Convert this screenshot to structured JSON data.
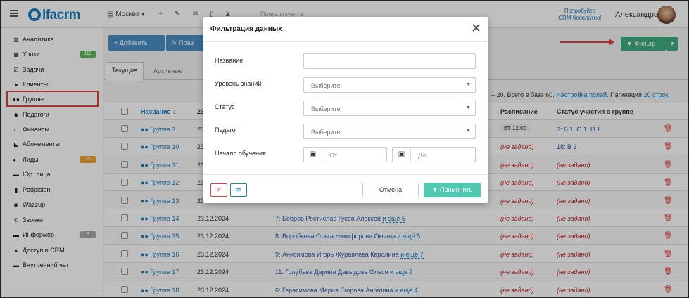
{
  "topbar": {
    "logo": "alfacrm",
    "city": "Москва",
    "add_icon": "+",
    "search_placeholder": "Поиск клиента",
    "try_line1": "Попробуйте",
    "try_line2": "CRM бесплатно!",
    "user_name": "Александра"
  },
  "sidebar": {
    "items": [
      {
        "label": "Аналитика",
        "icon": "chart-icon",
        "glyph": "▥"
      },
      {
        "label": "Уроки",
        "icon": "calendar-icon",
        "glyph": "▦",
        "badge": "112"
      },
      {
        "label": "Задачи",
        "icon": "tasks-icon",
        "glyph": "☑"
      },
      {
        "label": "Клиенты",
        "icon": "user-icon",
        "glyph": "●"
      },
      {
        "label": "Группы",
        "icon": "users-icon",
        "glyph": "●●"
      },
      {
        "label": "Педагоги",
        "icon": "graduation-cap-icon",
        "glyph": "◆"
      },
      {
        "label": "Финансы",
        "icon": "money-icon",
        "glyph": "▭"
      },
      {
        "label": "Абонементы",
        "icon": "tag-icon",
        "glyph": "◣"
      },
      {
        "label": "Лиды",
        "icon": "lead-icon",
        "glyph": "●+",
        "badge": "25"
      },
      {
        "label": "Юр. лица",
        "icon": "briefcase-icon",
        "glyph": "▬"
      },
      {
        "label": "Podpislon",
        "icon": "document-icon",
        "glyph": "▮"
      },
      {
        "label": "Wazzup",
        "icon": "whatsapp-icon",
        "glyph": "◉"
      },
      {
        "label": "Звонки",
        "icon": "phone-icon",
        "glyph": "✆"
      },
      {
        "label": "Информер",
        "icon": "informer-icon",
        "glyph": "▬",
        "badge": "3"
      },
      {
        "label": "Доступ в CRM",
        "icon": "lock-icon",
        "glyph": "▲"
      },
      {
        "label": "Внутренний чат",
        "icon": "chat-icon",
        "glyph": "▬"
      }
    ]
  },
  "toolbar": {
    "add_label": "+ Добавить",
    "edit_label": "✎ Прав",
    "filter_label": "▼ Фильтр"
  },
  "tabs": {
    "current": "Текущие",
    "archive": "Архивные"
  },
  "info": {
    "range": "– 20. Всего в базе 60.",
    "columns_link": "Настройка полей.",
    "pagination_label": "Пагинация",
    "pagination_value": "20 строк"
  },
  "table": {
    "headers": {
      "name": "Название ↓",
      "schedule": "Расписание",
      "status": "Статус участия в группе"
    },
    "header_partial": "23",
    "rows": [
      {
        "name": "Группа 1",
        "date": "23",
        "members": "",
        "more": "",
        "schedule": "ВТ 12:00",
        "status": "3: В 1, О 1, П 1"
      },
      {
        "name": "Группа 10",
        "date": "23",
        "members": "",
        "more": "",
        "schedule": "(не задано)",
        "status": "18: В 3"
      },
      {
        "name": "Группа 11",
        "date": "23",
        "members": "",
        "more": "",
        "schedule": "(не задано)",
        "status": "(не задано)"
      },
      {
        "name": "Группа 12",
        "date": "23",
        "members": "",
        "more": "",
        "schedule": "(не задано)",
        "status": "(не задано)"
      },
      {
        "name": "Группа 13",
        "date": "23",
        "members": "",
        "more": "",
        "schedule": "(не задано)",
        "status": "(не задано)"
      },
      {
        "name": "Группа 14",
        "date": "23.12.2024",
        "members": "7:  Бобров Ростислав  Гусев Алексей",
        "more": "и ещё 5",
        "schedule": "(не задано)",
        "status": "(не задано)"
      },
      {
        "name": "Группа 15",
        "date": "23.12.2024",
        "members": "8:  Воробьева Ольга  Никифорова Оксана",
        "more": "и ещё 5",
        "schedule": "(не задано)",
        "status": "(не задано)"
      },
      {
        "name": "Группа 16",
        "date": "23.12.2024",
        "members": "9:  Анисимова Игорь  Журавлева Каролина",
        "more": "и ещё 7",
        "schedule": "(не задано)",
        "status": "(не задано)"
      },
      {
        "name": "Группа 17",
        "date": "23.12.2024",
        "members": "11:  Голубева Дарина  Давыдова Олеся",
        "more": "и ещё 9",
        "schedule": "(не задано)",
        "status": "(не задано)"
      },
      {
        "name": "Группа 18",
        "date": "23.12.2024",
        "members": "6:  Герасимова Мария  Егорова Ангелина",
        "more": "и ещё 4",
        "schedule": "(не задано)",
        "status": "(не задано)"
      }
    ]
  },
  "modal": {
    "title": "Фильтрация данных",
    "close": "✕",
    "fields": {
      "name_label": "Название",
      "level_label": "Уровень знаний",
      "level_placeholder": "Выберите",
      "status_label": "Статус",
      "status_placeholder": "Выберите",
      "teacher_label": "Педагог",
      "teacher_placeholder": "Выберите",
      "start_label": "Начало обучения",
      "from_placeholder": "От",
      "to_placeholder": "До"
    },
    "cancel_label": "Отмена",
    "apply_label": "▼ Применить"
  },
  "colors": {
    "accent_blue": "#1a7fc1",
    "green": "#3fae80",
    "teal": "#4fc9b0",
    "red": "#e04040",
    "badge_green": "#5cb85c",
    "badge_orange": "#f0a030",
    "badge_gray": "#aaa"
  }
}
